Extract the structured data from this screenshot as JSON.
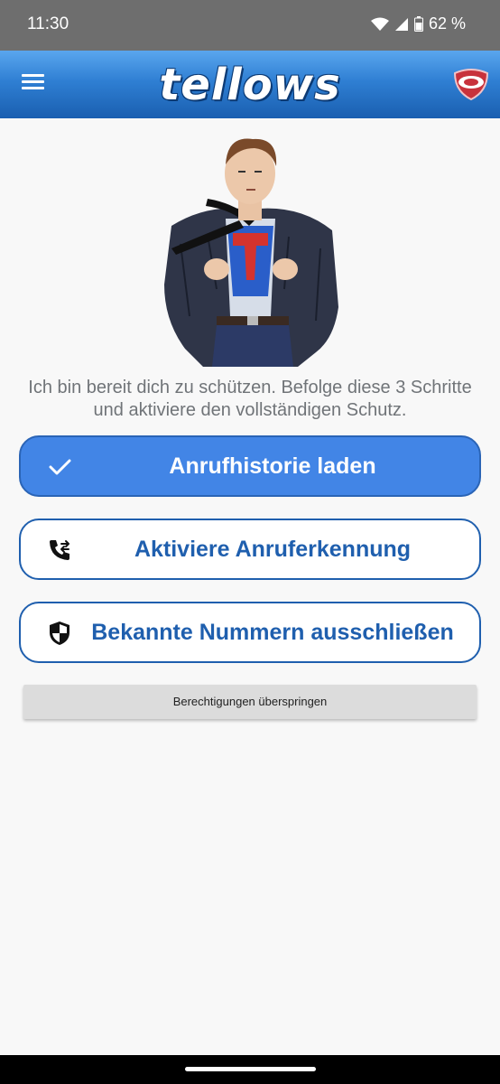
{
  "status": {
    "time": "11:30",
    "battery": "62 %"
  },
  "app": {
    "logo_text": "tellows"
  },
  "intro": "Ich bin bereit dich zu schützen. Befolge diese 3 Schritte und aktiviere den vollständigen Schutz.",
  "steps": [
    {
      "label": "Anrufhistorie laden",
      "icon": "check-icon",
      "done": true
    },
    {
      "label": "Aktiviere Anruferkennung",
      "icon": "phone-forward-icon",
      "done": false
    },
    {
      "label": "Bekannte Nummern ausschließen",
      "icon": "shield-icon",
      "done": false
    }
  ],
  "skip_label": "Berechtigungen überspringen",
  "colors": {
    "primary": "#1f5fae",
    "done_bg": "#4285e6",
    "app_bar": "#2f7fd3",
    "status_bar": "#6e6e6e"
  }
}
